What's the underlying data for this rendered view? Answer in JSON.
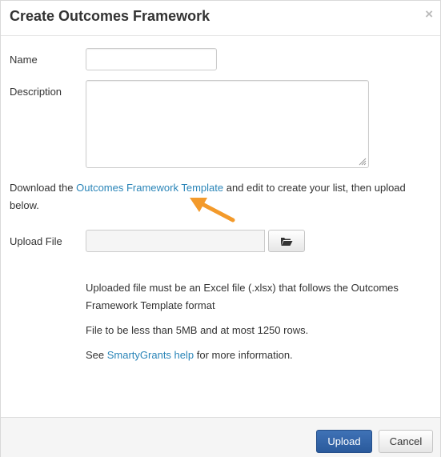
{
  "dialog": {
    "title": "Create Outcomes Framework",
    "close_symbol": "×"
  },
  "form": {
    "name_label": "Name",
    "name_value": "",
    "description_label": "Description",
    "description_value": "",
    "download_prefix": "Download the ",
    "download_link": "Outcomes Framework Template",
    "download_suffix": " and edit to create your list, then upload below.",
    "upload_label": "Upload File",
    "upload_value": "",
    "browse_icon": "folder-open-icon"
  },
  "info": {
    "line1": "Uploaded file must be an Excel file (.xlsx) that follows the Outcomes Framework Template format",
    "line2": "File to be less than 5MB and at most 1250 rows.",
    "help_prefix": "See ",
    "help_link": "SmartyGrants help",
    "help_suffix": " for more information."
  },
  "footer": {
    "upload_label": "Upload",
    "cancel_label": "Cancel"
  },
  "colors": {
    "link": "#2a85b8",
    "arrow": "#f39a2b",
    "primary_button": "#3366aa"
  }
}
